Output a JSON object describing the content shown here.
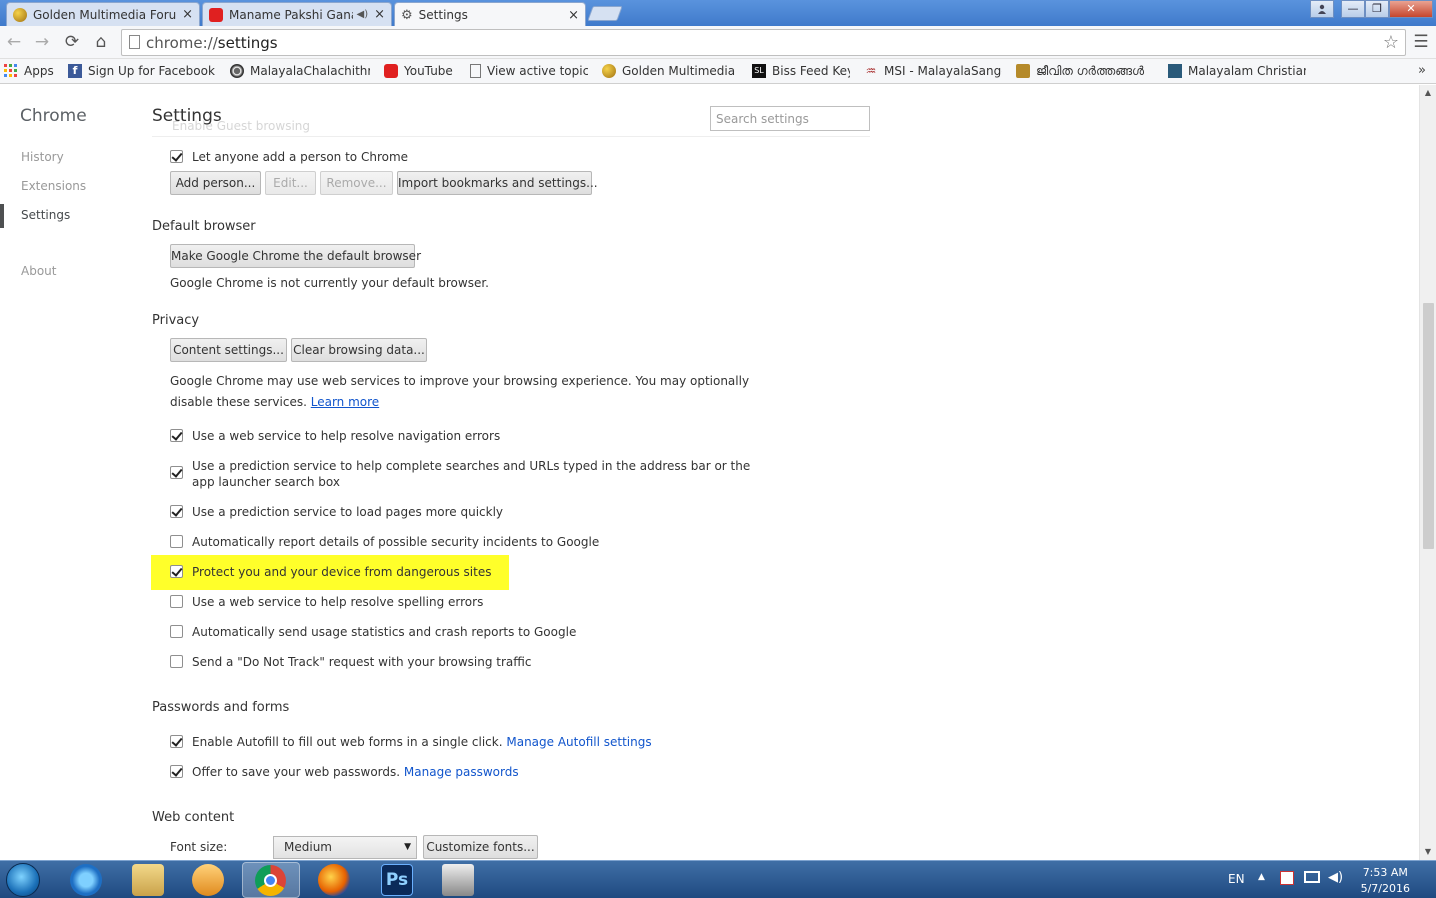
{
  "tabs": [
    {
      "label": "Golden Multimedia Forum",
      "favicon_color": "#c8a020",
      "close": "×",
      "active": false
    },
    {
      "label": "Maname Pakshi Ganan",
      "favicon_color": "#e02020",
      "close": "×",
      "audio": "◀)",
      "active": false
    },
    {
      "label": "Settings",
      "favicon_icon": "⚙",
      "close": "×",
      "active": true
    }
  ],
  "window": {
    "user_icon": "user-icon",
    "minimize": "—",
    "restore": "❐",
    "close": "✕"
  },
  "toolbar": {
    "back": "←",
    "forward": "→",
    "reload": "⟳",
    "home": "⌂",
    "menu": "☰",
    "star": "☆",
    "url_scheme": "chrome://",
    "url_host": "settings"
  },
  "bookmarks": [
    {
      "label": "Apps",
      "icon": "apps-icon"
    },
    {
      "label": "Sign Up for Facebook",
      "icon": "facebook-icon"
    },
    {
      "label": "MalayalaChalachithra",
      "icon": "film-icon"
    },
    {
      "label": "YouTube",
      "icon": "youtube-icon"
    },
    {
      "label": "View active topics",
      "icon": "page-icon"
    },
    {
      "label": "Golden Multimedia Fo",
      "icon": "golden-icon"
    },
    {
      "label": "Biss Feed Keys",
      "icon": "biss-icon"
    },
    {
      "label": "MSI - MalayalaSangee",
      "icon": "msi-icon"
    },
    {
      "label": "ജീവിത ഗർത്തങ്ങൾ",
      "icon": "person-icon"
    },
    {
      "label": "Malayalam Christian S",
      "icon": "christian-icon"
    }
  ],
  "bookmarks_overflow": "»",
  "sidebar": {
    "brand": "Chrome",
    "items": [
      "History",
      "Extensions",
      "Settings",
      "About"
    ],
    "active": "Settings"
  },
  "header": {
    "title": "Settings",
    "ghost_text": "Enable Guest browsing",
    "search_placeholder": "Search settings"
  },
  "people": {
    "let_anyone_add": "Let anyone add a person to Chrome",
    "buttons": {
      "add": "Add person...",
      "edit": "Edit...",
      "remove": "Remove...",
      "import": "Import bookmarks and settings..."
    }
  },
  "default_browser": {
    "heading": "Default browser",
    "button": "Make Google Chrome the default browser",
    "status": "Google Chrome is not currently your default browser."
  },
  "privacy": {
    "heading": "Privacy",
    "content_settings": "Content settings...",
    "clear_data": "Clear browsing data...",
    "description": "Google Chrome may use web services to improve your browsing experience. You may optionally disable these services.",
    "learn_more": "Learn more",
    "options": [
      {
        "label": "Use a web service to help resolve navigation errors",
        "checked": true
      },
      {
        "label": "Use a prediction service to help complete searches and URLs typed in the address bar or the app launcher search box",
        "checked": true
      },
      {
        "label": "Use a prediction service to load pages more quickly",
        "checked": true
      },
      {
        "label": "Automatically report details of possible security incidents to Google",
        "checked": false
      },
      {
        "label": "Protect you and your device from dangerous sites",
        "checked": true
      },
      {
        "label": "Use a web service to help resolve spelling errors",
        "checked": false
      },
      {
        "label": "Automatically send usage statistics and crash reports to Google",
        "checked": false
      },
      {
        "label": "Send a \"Do Not Track\" request with your browsing traffic",
        "checked": false
      }
    ],
    "highlight_color": "#ffff2a"
  },
  "passwords": {
    "heading": "Passwords and forms",
    "autofill": "Enable Autofill to fill out web forms in a single click.",
    "autofill_link": "Manage Autofill settings",
    "save_passwords": "Offer to save your web passwords.",
    "passwords_link": "Manage passwords"
  },
  "web_content": {
    "heading": "Web content",
    "font_size_label": "Font size:",
    "font_size_value": "Medium",
    "customize_fonts": "Customize fonts..."
  },
  "taskbar": {
    "language": "EN",
    "time": "7:53 AM",
    "date": "5/7/2016",
    "apps": [
      "internet-explorer-icon",
      "file-explorer-icon",
      "media-player-icon",
      "chrome-icon",
      "firefox-icon",
      "photoshop-icon",
      "typewriter-icon"
    ],
    "photoshop_label": "Ps"
  },
  "colors": {
    "accent": "#1155cc",
    "titlebar": "#4b86d3",
    "taskbar": "#2b5b93"
  }
}
